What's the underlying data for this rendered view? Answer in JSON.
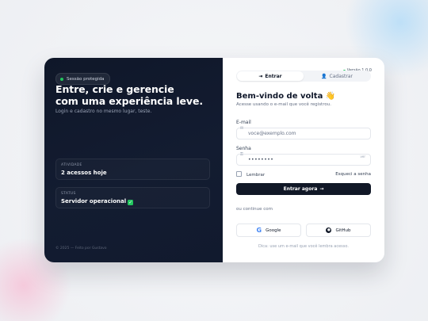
{
  "left": {
    "badge": "Sessão protegida",
    "headline_line1": "Entre, crie e gerencie",
    "headline_line2": "com uma experiência leve.",
    "subtitle": "Login e cadastro no mesmo lugar, teste.",
    "stats": [
      {
        "label": "ATIVIDADE",
        "value": "2 acessos hoje"
      },
      {
        "label": "STATUS",
        "value": "Servidor operacional"
      }
    ],
    "footer": "© 2025 — Feito por Gustavo"
  },
  "right": {
    "version": "Versão 1.0.0",
    "tabs": [
      {
        "label": "Entrar",
        "icon": "login-arrow-icon",
        "active": true
      },
      {
        "label": "Cadastrar",
        "icon": "user-icon",
        "active": false
      }
    ],
    "title": "Bem-vindo de volta 👋",
    "subtitle": "Acesse usando o e-mail que você registrou.",
    "email": {
      "label": "E-mail",
      "placeholder": "voce@exemplo.com"
    },
    "password": {
      "label": "Senha",
      "value": "••••••••",
      "toggle_label": "ver"
    },
    "remember_label": "Lembrar",
    "forgot_label": "Esqueci a senha",
    "submit_label": "Entrar agora",
    "divider_text": "ou continue com",
    "social": [
      {
        "label": "Google",
        "icon": "google-icon"
      },
      {
        "label": "GitHub",
        "icon": "github-icon"
      }
    ],
    "hint": "Dica: use um e-mail que você lembra acesso."
  },
  "colors": {
    "left_bg": "#0f1729",
    "accent_dark": "#111827",
    "status_green": "#22c55e"
  }
}
